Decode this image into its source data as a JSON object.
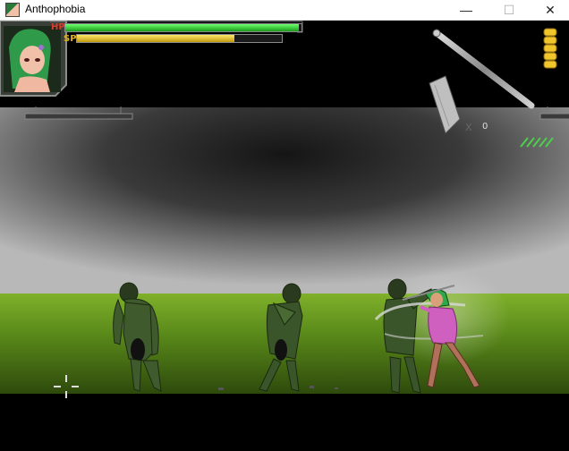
{
  "window": {
    "title": "Anthophobia",
    "app_icon": "anthophobia-app-icon",
    "controls": {
      "minimize": "—",
      "maximize": "☐",
      "close": "✕"
    }
  },
  "hud": {
    "hp": {
      "label": "HP",
      "level": 0.99,
      "color": "#2fd12f"
    },
    "sp": {
      "label": "SP",
      "level": 0.77,
      "color": "#e8c21a"
    },
    "ammo": {
      "prefix": "X",
      "count": "0"
    },
    "weapon_icon": "pipe-weapon-icon",
    "secondary_weapon_icon": "cleaver-icon",
    "bullet_icon": "bullet-stack-icon",
    "bullets": 5
  },
  "scene": {
    "floor_color": "#5a8a1a",
    "sky_color": "#9a9a9a",
    "enemies": 3,
    "player": "green-haired-heroine"
  }
}
